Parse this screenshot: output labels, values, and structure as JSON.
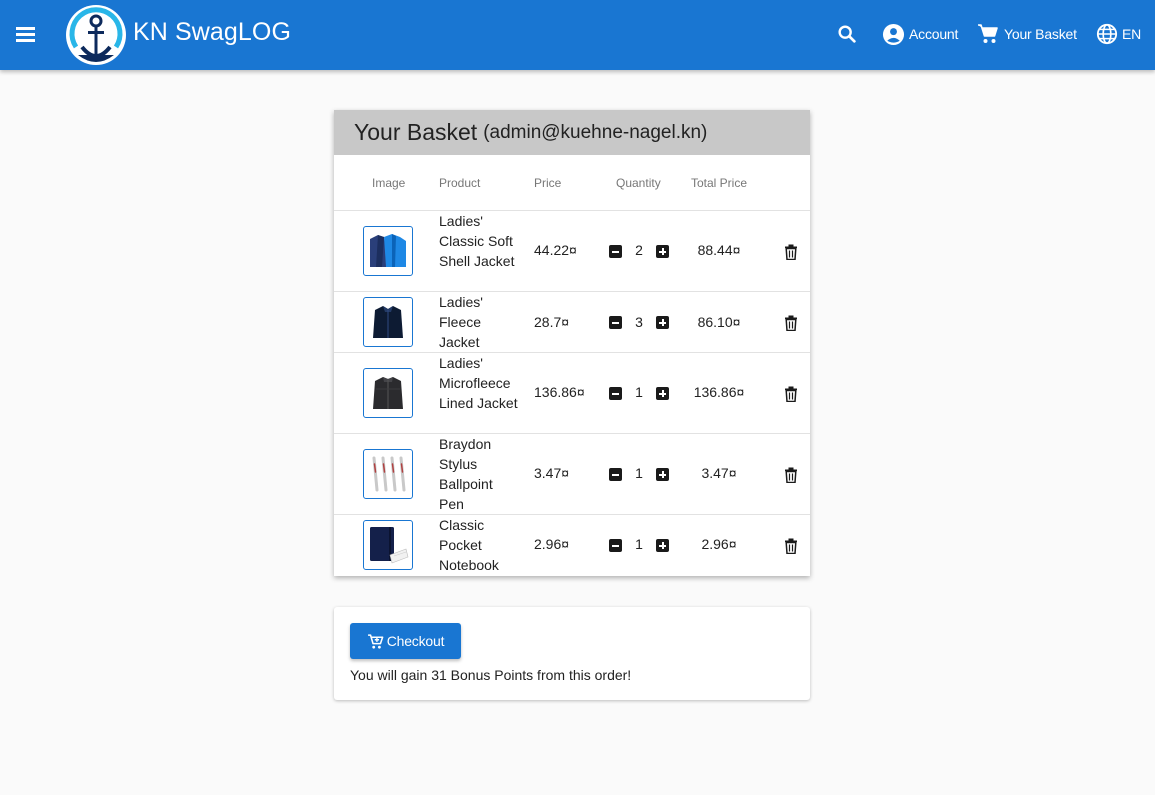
{
  "app": {
    "title": "KN SwagLOG"
  },
  "nav": {
    "account_label": "Account",
    "basket_label": "Your Basket",
    "language_label": "EN"
  },
  "basket": {
    "title": "Your Basket",
    "user": "(admin@kuehne-nagel.kn)",
    "columns": {
      "image": "Image",
      "product": "Product",
      "price": "Price",
      "quantity": "Quantity",
      "total": "Total Price"
    },
    "items": [
      {
        "name": "Ladies' Classic Soft Shell Jacket",
        "price": "44.22¤",
        "quantity": "2",
        "total": "88.44¤"
      },
      {
        "name": "Ladies' Fleece Jacket",
        "price": "28.7¤",
        "quantity": "3",
        "total": "86.10¤"
      },
      {
        "name": "Ladies' Microfleece Lined Jacket",
        "price": "136.86¤",
        "quantity": "1",
        "total": "136.86¤"
      },
      {
        "name": "Braydon Stylus Ballpoint Pen",
        "price": "3.47¤",
        "quantity": "1",
        "total": "3.47¤"
      },
      {
        "name": "Classic Pocket Notebook",
        "price": "2.96¤",
        "quantity": "1",
        "total": "2.96¤"
      }
    ]
  },
  "checkout": {
    "button_label": "Checkout",
    "bonus_text": "You will gain 31 Bonus Points from this order!"
  },
  "colors": {
    "primary": "#1976d2",
    "header_gray": "#c8c8c8",
    "background": "#fafafa"
  },
  "icons": [
    "menu-icon",
    "anchor-logo",
    "search-icon",
    "account-icon",
    "cart-icon",
    "globe-icon",
    "minus-icon",
    "plus-icon",
    "trash-icon",
    "cart-add-icon"
  ]
}
